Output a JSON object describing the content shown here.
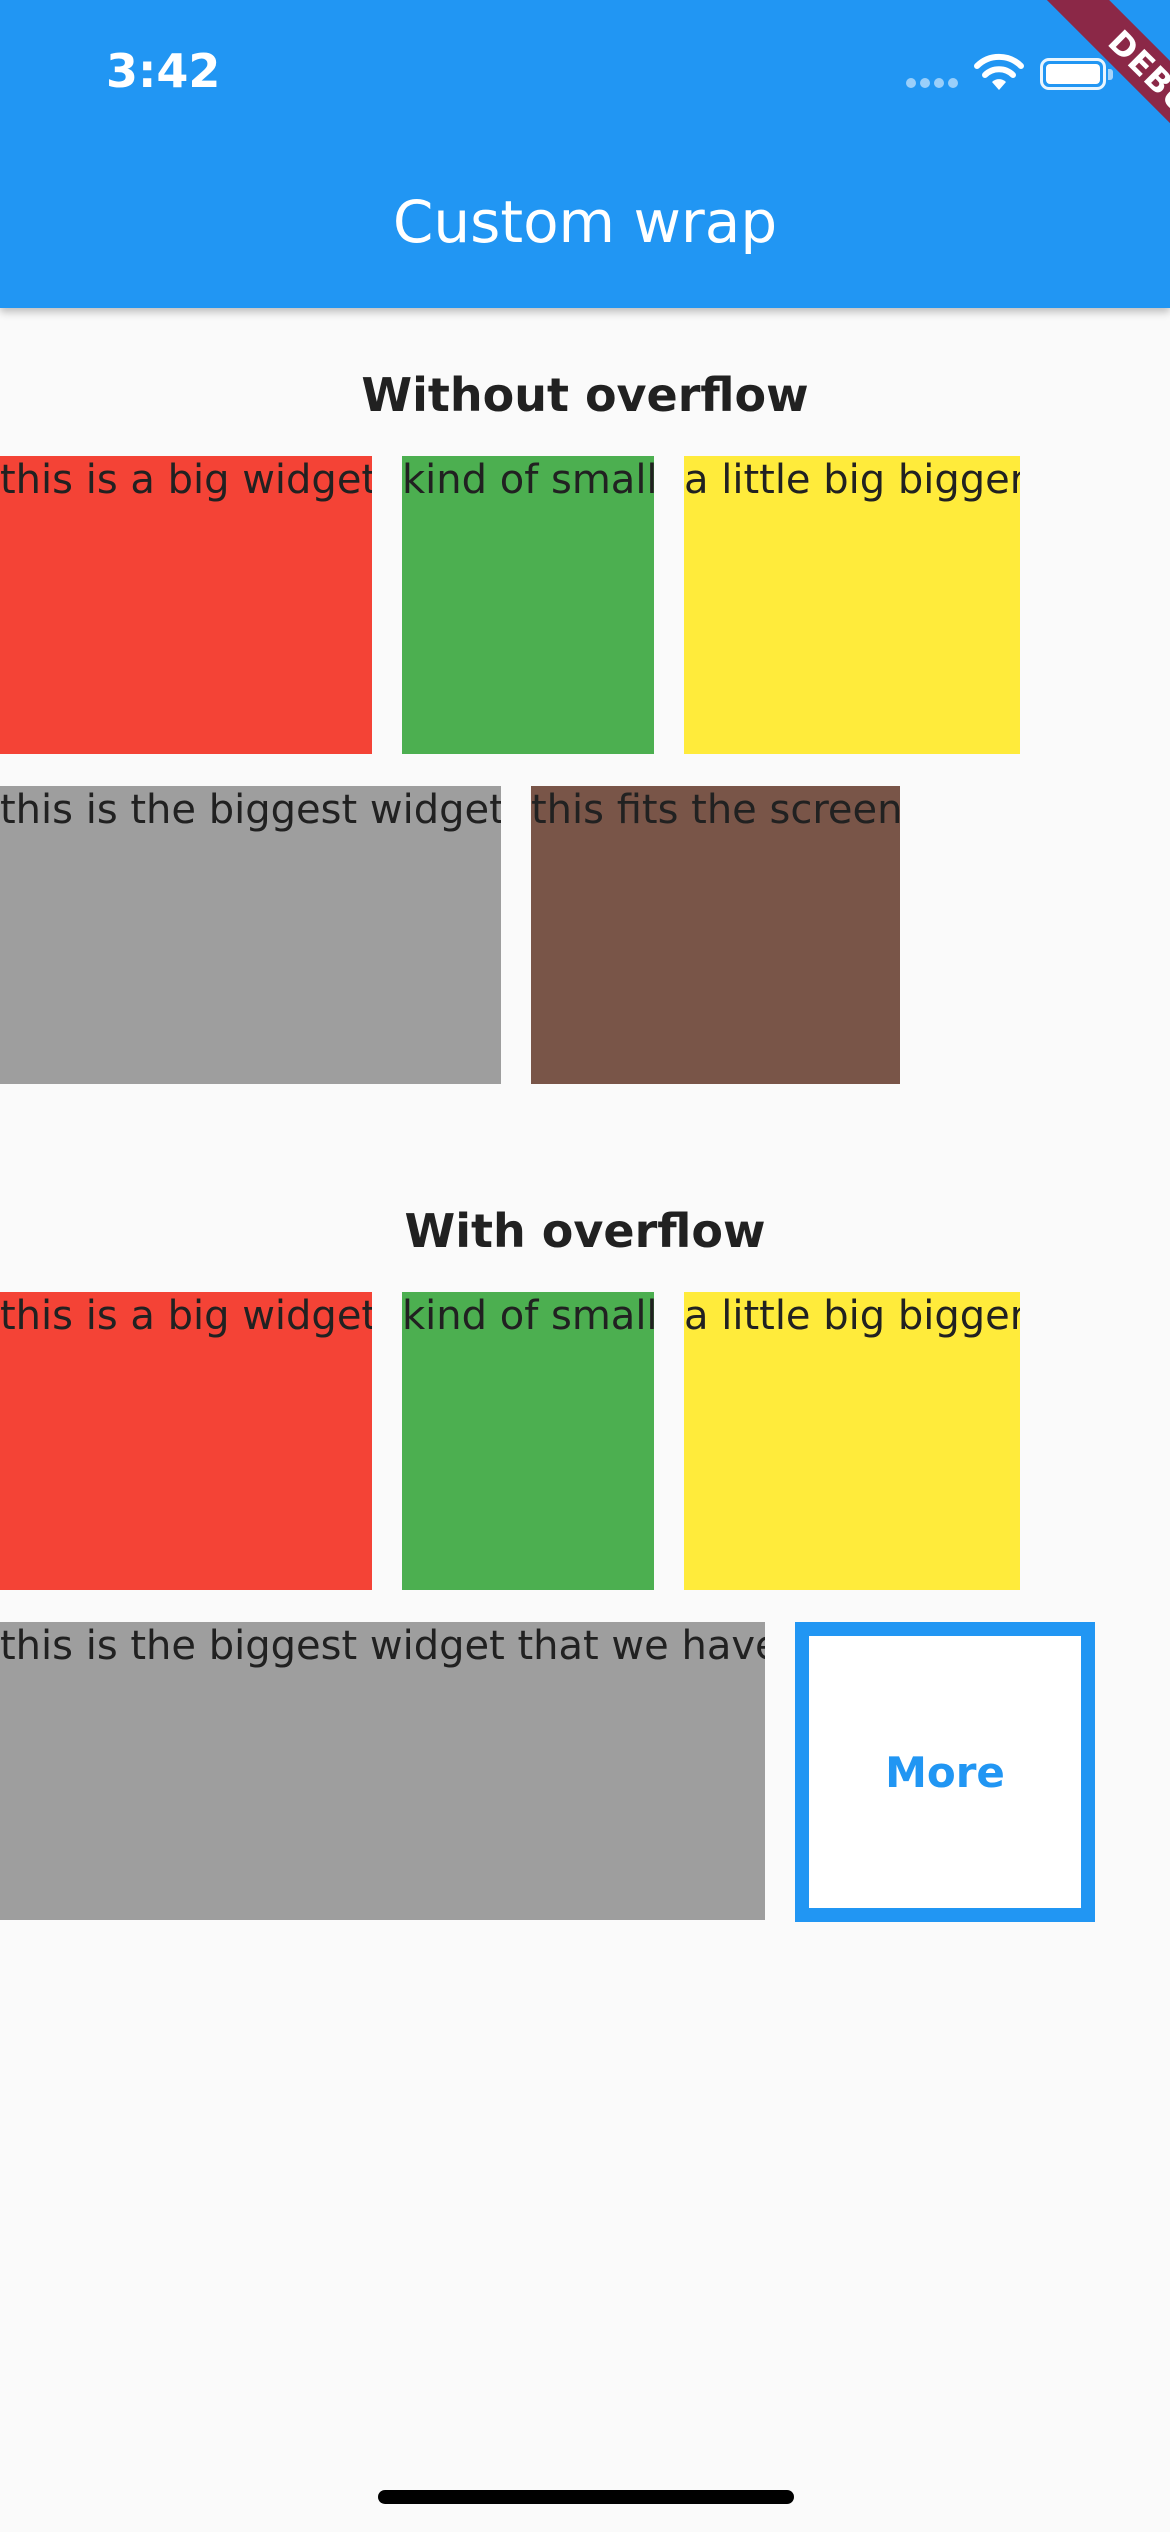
{
  "status_bar": {
    "time": "3:42"
  },
  "debug_banner": "DEBUG",
  "app_bar": {
    "title": "Custom wrap"
  },
  "sections": [
    {
      "heading": "Without overflow",
      "items": [
        {
          "label": "this is a big widget",
          "color": "#F44336"
        },
        {
          "label": "kind of small",
          "color": "#4CAF50"
        },
        {
          "label": "a little big bigger",
          "color": "#FFEB3B"
        },
        {
          "label": "this is the biggest widget",
          "color": "#9E9E9E"
        },
        {
          "label": "this fits the screen",
          "color": "#795548"
        }
      ]
    },
    {
      "heading": "With overflow",
      "items": [
        {
          "label": "this is a big widget",
          "color": "#F44336"
        },
        {
          "label": "kind of small",
          "color": "#4CAF50"
        },
        {
          "label": "a little big bigger",
          "color": "#FFEB3B"
        },
        {
          "label": "this is the biggest widget that we have",
          "color": "#9E9E9E"
        }
      ],
      "more_label": "More"
    }
  ],
  "colors": {
    "primary": "#2196F3",
    "background": "#FAFAFA",
    "ribbon": "#8B2847"
  }
}
